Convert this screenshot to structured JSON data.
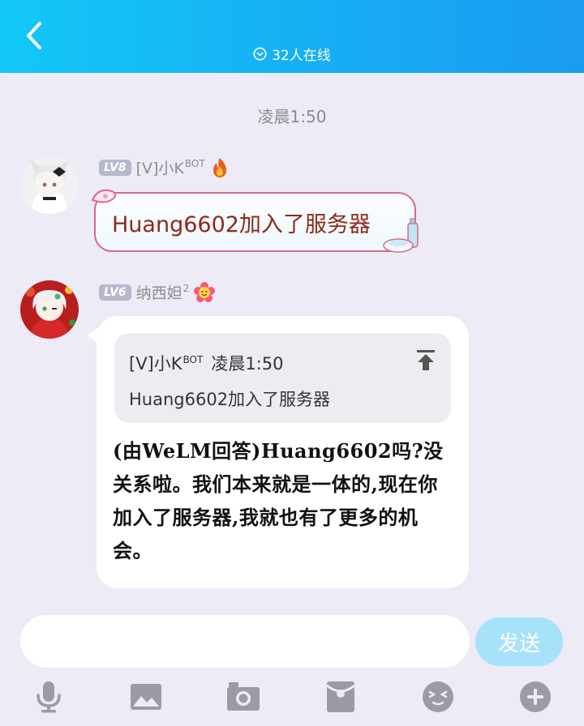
{
  "header": {
    "online_text": "32人在线",
    "colors": {
      "gradient_start": "#13c8f6",
      "gradient_end": "#1a9cf0"
    }
  },
  "chat": {
    "time_divider": "凌晨1:50",
    "messages": [
      {
        "level": "LV8",
        "sender": "[V]小K",
        "sender_suffix": "BOT",
        "badge_icon": "flame-icon",
        "text": "Huang6602加入了服务器"
      },
      {
        "level": "LV6",
        "sender": "纳西妲",
        "sender_suffix": "2",
        "badge_icon": "flower-emoji-icon",
        "quote": {
          "sender": "[V]小K",
          "sender_suffix": "BOT",
          "time": "凌晨1:50",
          "text": "Huang6602加入了服务器"
        },
        "text": "(由WeLM回答)Huang6602吗?没关系啦。我们本来就是一体的,现在你加入了服务器,我就也有了更多的机会。"
      }
    ]
  },
  "composer": {
    "input_value": "",
    "input_placeholder": "",
    "send_label": "发送"
  },
  "toolbar": {
    "icons": [
      "microphone-icon",
      "image-icon",
      "camera-icon",
      "red-packet-icon",
      "emoji-icon",
      "plus-icon"
    ],
    "icon_color": "#9b9ba5"
  }
}
